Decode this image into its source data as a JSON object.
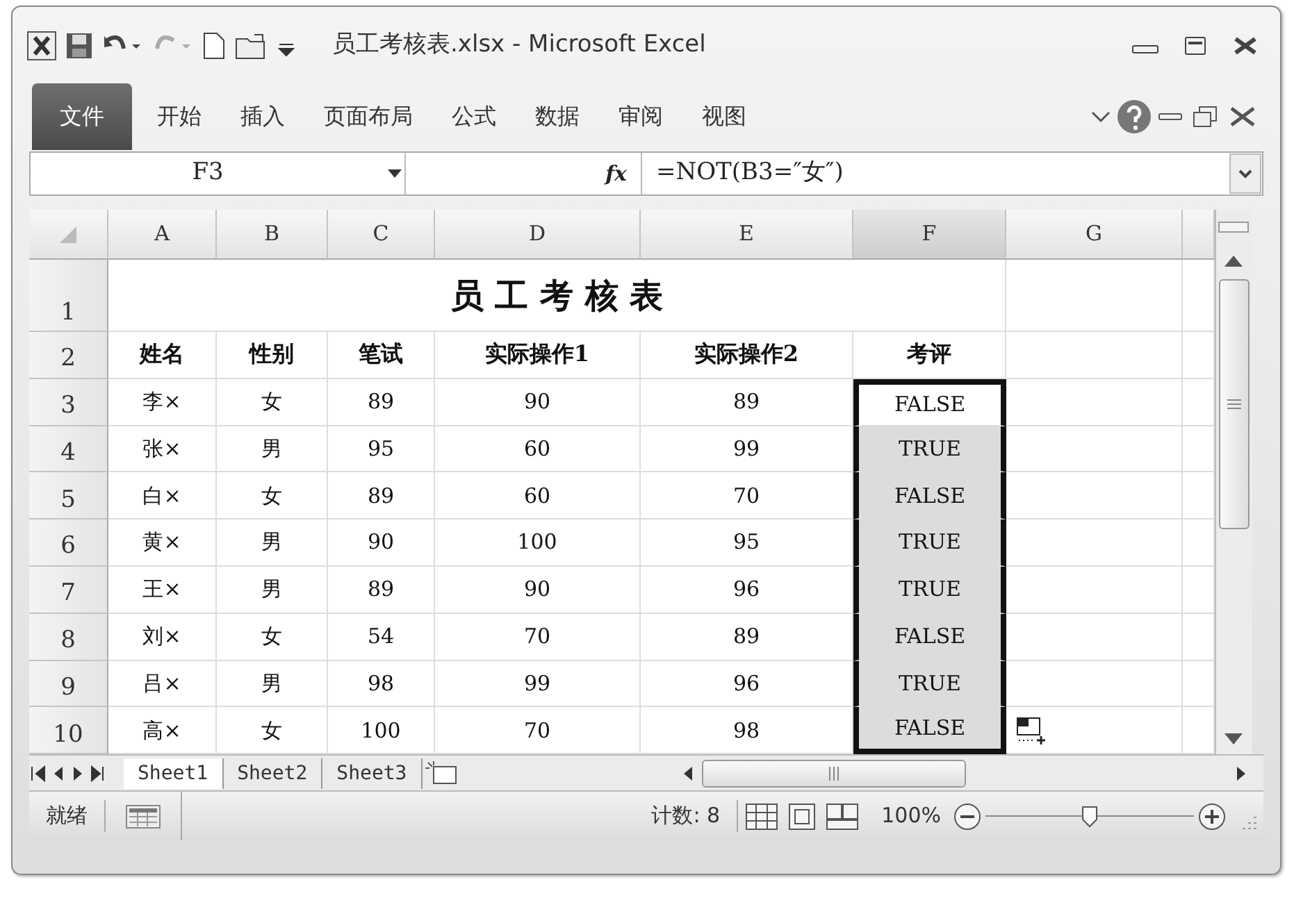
{
  "window": {
    "title": "员工考核表.xlsx - Microsoft Excel"
  },
  "ribbon_tabs": [
    {
      "label": "文件",
      "kind": "file"
    },
    {
      "label": "开始",
      "kind": "tab"
    },
    {
      "label": "插入",
      "kind": "tab"
    },
    {
      "label": "页面布局",
      "kind": "tab"
    },
    {
      "label": "公式",
      "kind": "tab"
    },
    {
      "label": "数据",
      "kind": "tab"
    },
    {
      "label": "审阅",
      "kind": "tab"
    },
    {
      "label": "视图",
      "kind": "tab"
    }
  ],
  "formula_bar": {
    "name_box": "F3",
    "fx": "fx",
    "formula": "=NOT(B3=″女″)"
  },
  "columns": [
    {
      "label": "A",
      "selected": false
    },
    {
      "label": "B",
      "selected": false
    },
    {
      "label": "C",
      "selected": false
    },
    {
      "label": "D",
      "selected": false
    },
    {
      "label": "E",
      "selected": false
    },
    {
      "label": "F",
      "selected": true
    },
    {
      "label": "G",
      "selected": false
    }
  ],
  "title_row": {
    "number": "1",
    "text": "员 工 考 核 表"
  },
  "header_row": {
    "number": "2",
    "cells": [
      "姓名",
      "性别",
      "笔试",
      "实际操作1",
      "实际操作2",
      "考评"
    ]
  },
  "rows": [
    {
      "number": "3",
      "cells": [
        "李×",
        "女",
        "89",
        "90",
        "89",
        "FALSE"
      ],
      "selected": true,
      "active": true
    },
    {
      "number": "4",
      "cells": [
        "张×",
        "男",
        "95",
        "60",
        "99",
        "TRUE"
      ],
      "selected": true,
      "active": false
    },
    {
      "number": "5",
      "cells": [
        "白×",
        "女",
        "89",
        "60",
        "70",
        "FALSE"
      ],
      "selected": true,
      "active": false
    },
    {
      "number": "6",
      "cells": [
        "黄×",
        "男",
        "90",
        "100",
        "95",
        "TRUE"
      ],
      "selected": true,
      "active": false
    },
    {
      "number": "7",
      "cells": [
        "王×",
        "男",
        "89",
        "90",
        "96",
        "TRUE"
      ],
      "selected": true,
      "active": false
    },
    {
      "number": "8",
      "cells": [
        "刘×",
        "女",
        "54",
        "70",
        "89",
        "FALSE"
      ],
      "selected": true,
      "active": false
    },
    {
      "number": "9",
      "cells": [
        "吕×",
        "男",
        "98",
        "99",
        "96",
        "TRUE"
      ],
      "selected": true,
      "active": false
    },
    {
      "number": "10",
      "cells": [
        "高×",
        "女",
        "100",
        "70",
        "98",
        "FALSE"
      ],
      "selected": true,
      "active": false
    }
  ],
  "sheet_tabs": [
    {
      "label": "Sheet1",
      "selected": true
    },
    {
      "label": "Sheet2",
      "selected": false
    },
    {
      "label": "Sheet3",
      "selected": false
    }
  ],
  "status_bar": {
    "mode": "就绪",
    "count": "计数: 8",
    "zoom": "100%",
    "zoom_level": {
      "level": 0.5
    }
  }
}
